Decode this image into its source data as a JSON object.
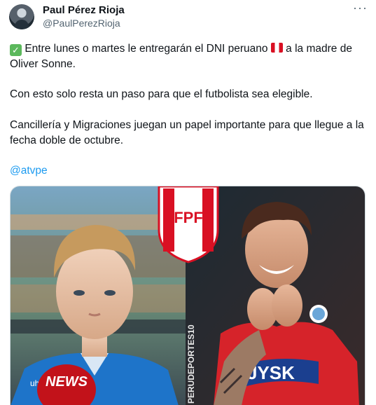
{
  "author": {
    "name": "Paul Pérez Rioja",
    "handle": "@PaulPerezRioja"
  },
  "tweet": {
    "p1_before_flag": "Entre lunes o martes le entregarán el DNI peruano",
    "p1_after_flag": "a la madre de Oliver Sonne.",
    "p2": "Con esto solo resta un paso para que el futbolista sea elegible.",
    "p3": "Cancillería y Migraciones juegan un papel importante para que llegue a la fecha doble de octubre.",
    "mention": "@atvpe"
  },
  "image": {
    "crest_text": "FPF",
    "watermark": "PERUDEPORTES10",
    "mic_text": "NEWS",
    "sponsor_text": "JYSK",
    "kit_text": "uhlsport"
  }
}
